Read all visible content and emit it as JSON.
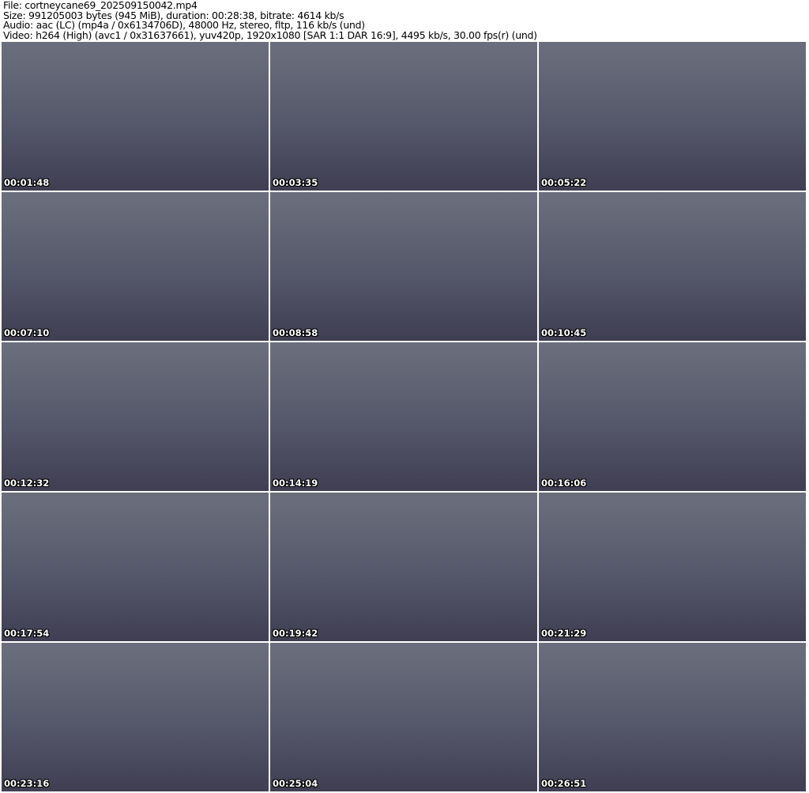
{
  "header": {
    "file": "File: cortneycane69_202509150042.mp4",
    "size": "Size: 991205003 bytes (945 MiB), duration: 00:28:38, bitrate: 4614 kb/s",
    "audio": "Audio: aac (LC) (mp4a / 0x6134706D), 48000 Hz, stereo, fltp, 116 kb/s (und)",
    "video": "Video: h264 (High) (avc1 / 0x31637661), yuv420p, 1920x1080 [SAR 1:1 DAR 16:9], 4495 kb/s, 30.00 fps(r) (und)"
  },
  "thumbnails": [
    "00:01:48",
    "00:03:35",
    "00:05:22",
    "00:07:10",
    "00:08:58",
    "00:10:45",
    "00:12:32",
    "00:14:19",
    "00:16:06",
    "00:17:54",
    "00:19:42",
    "00:21:29",
    "00:23:16",
    "00:25:04",
    "00:26:51"
  ]
}
